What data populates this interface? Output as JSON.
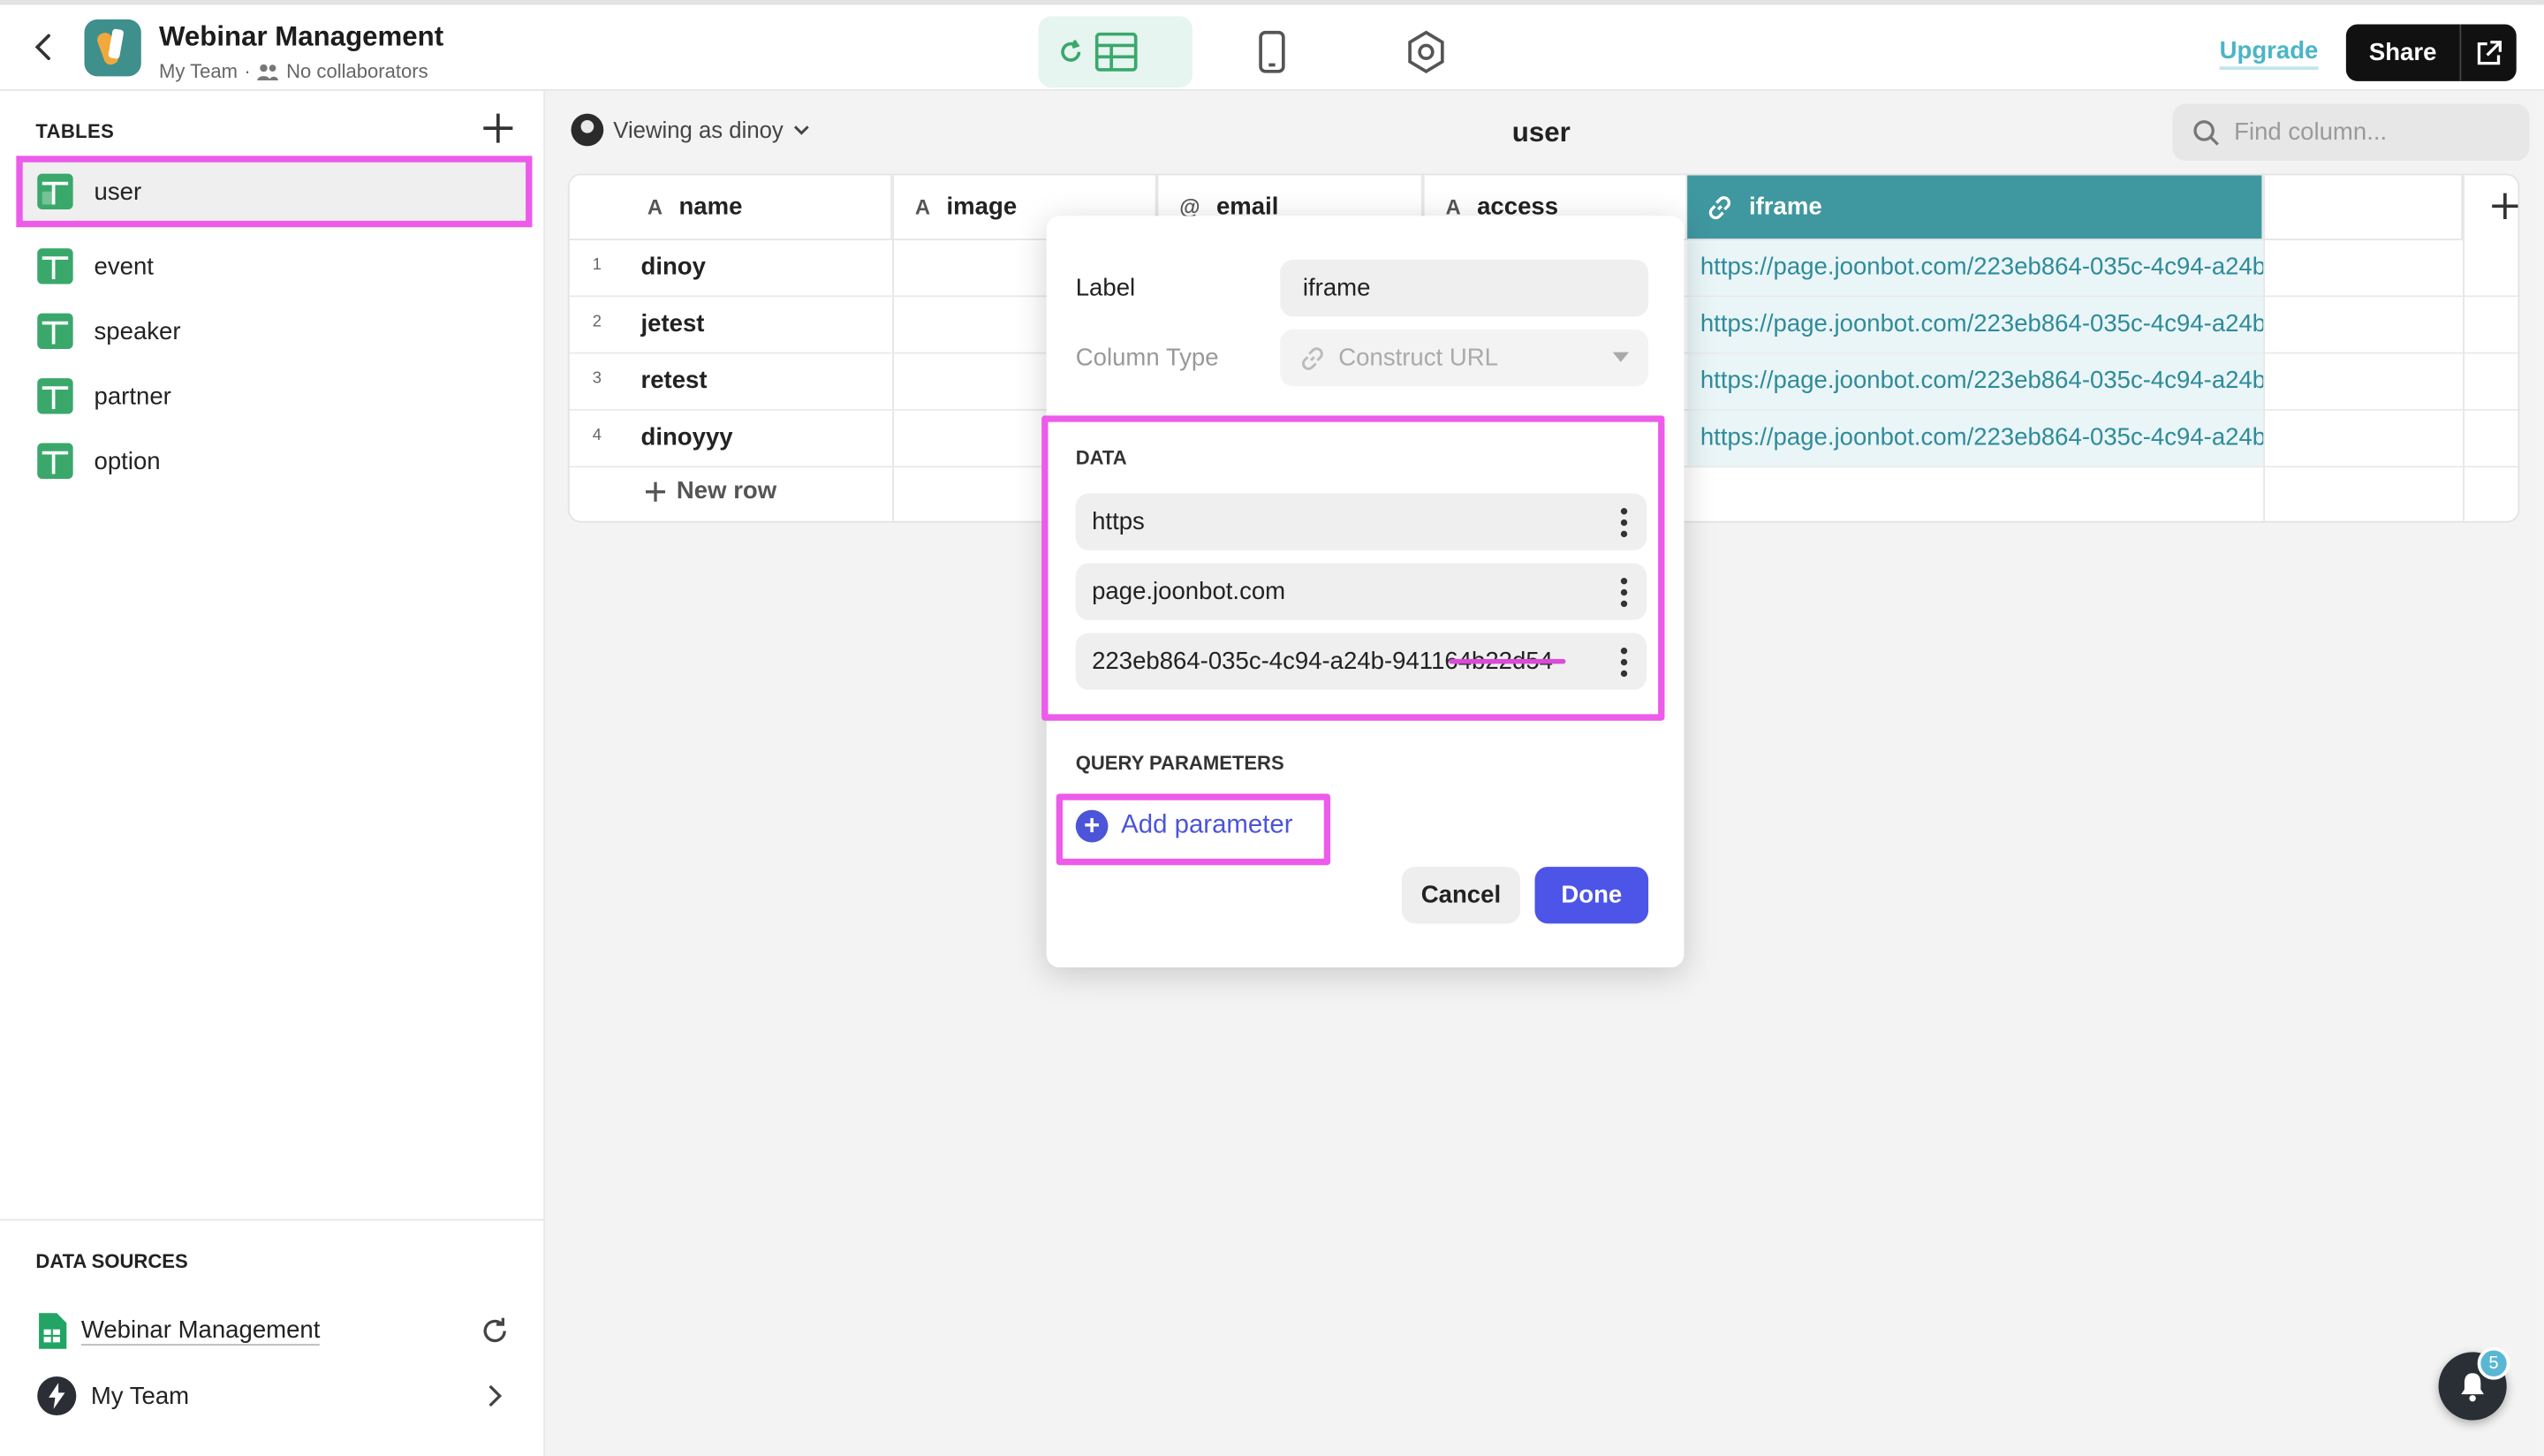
{
  "header": {
    "app_title": "Webinar Management",
    "team": "My Team",
    "separator": "·",
    "collaborators": "No collaborators",
    "upgrade_label": "Upgrade",
    "share_label": "Share"
  },
  "sidebar": {
    "tables_heading": "TABLES",
    "tables": [
      {
        "label": "user",
        "selected": true
      },
      {
        "label": "event"
      },
      {
        "label": "speaker"
      },
      {
        "label": "partner"
      },
      {
        "label": "option"
      }
    ],
    "data_sources_heading": "DATA SOURCES",
    "data_sources": [
      {
        "label": "Webinar Management",
        "icon": "google-sheets-icon"
      },
      {
        "label": "My Team",
        "icon": "lightning-icon"
      }
    ]
  },
  "main": {
    "viewing_label": "Viewing as dinoy",
    "title": "user",
    "find_placeholder": "Find column...",
    "columns": [
      {
        "label": "name",
        "icon_glyph": "A"
      },
      {
        "label": "image",
        "icon_glyph": "A"
      },
      {
        "label": "email",
        "icon_glyph": "@"
      },
      {
        "label": "access",
        "icon_glyph": "A"
      },
      {
        "label": "iframe",
        "icon_glyph": "🔗"
      }
    ],
    "rows": [
      {
        "num": "1",
        "name": "dinoy",
        "iframe": "https://page.joonbot.com/223eb864-035c-4c94-a24b"
      },
      {
        "num": "2",
        "name": "jetest",
        "iframe": "https://page.joonbot.com/223eb864-035c-4c94-a24b"
      },
      {
        "num": "3",
        "name": "retest",
        "iframe": "https://page.joonbot.com/223eb864-035c-4c94-a24b"
      },
      {
        "num": "4",
        "name": "dinoyyy",
        "iframe": "https://page.joonbot.com/223eb864-035c-4c94-a24b"
      }
    ],
    "new_row_label": "New row"
  },
  "modal": {
    "label_caption": "Label",
    "label_value": "iframe",
    "column_type_caption": "Column Type",
    "column_type_value": "Construct URL",
    "data_heading": "DATA",
    "data_items": [
      "https",
      "page.joonbot.com",
      "223eb864-035c-4c94-a24b-941164b22d54"
    ],
    "query_heading": "QUERY PARAMETERS",
    "add_parameter_label": "Add parameter",
    "cancel_label": "Cancel",
    "done_label": "Done"
  },
  "notifications": {
    "badge_count": "5"
  },
  "colors": {
    "accent_highlight": "#ec5bea",
    "primary_button": "#4c55e8",
    "active_column": "#3f97a0",
    "link_text": "#2f8b99"
  }
}
